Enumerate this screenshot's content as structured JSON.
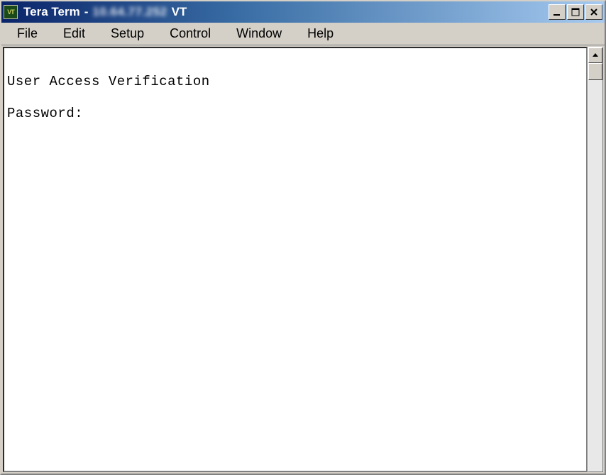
{
  "window": {
    "icon_label": "VT",
    "title_app": "Tera Term",
    "title_sep": "-",
    "title_host": "10.64.77.252",
    "title_suffix": "VT"
  },
  "menubar": {
    "items": [
      "File",
      "Edit",
      "Setup",
      "Control",
      "Window",
      "Help"
    ]
  },
  "terminal": {
    "line1": "",
    "line2": "User Access Verification",
    "line3": "Password:"
  }
}
